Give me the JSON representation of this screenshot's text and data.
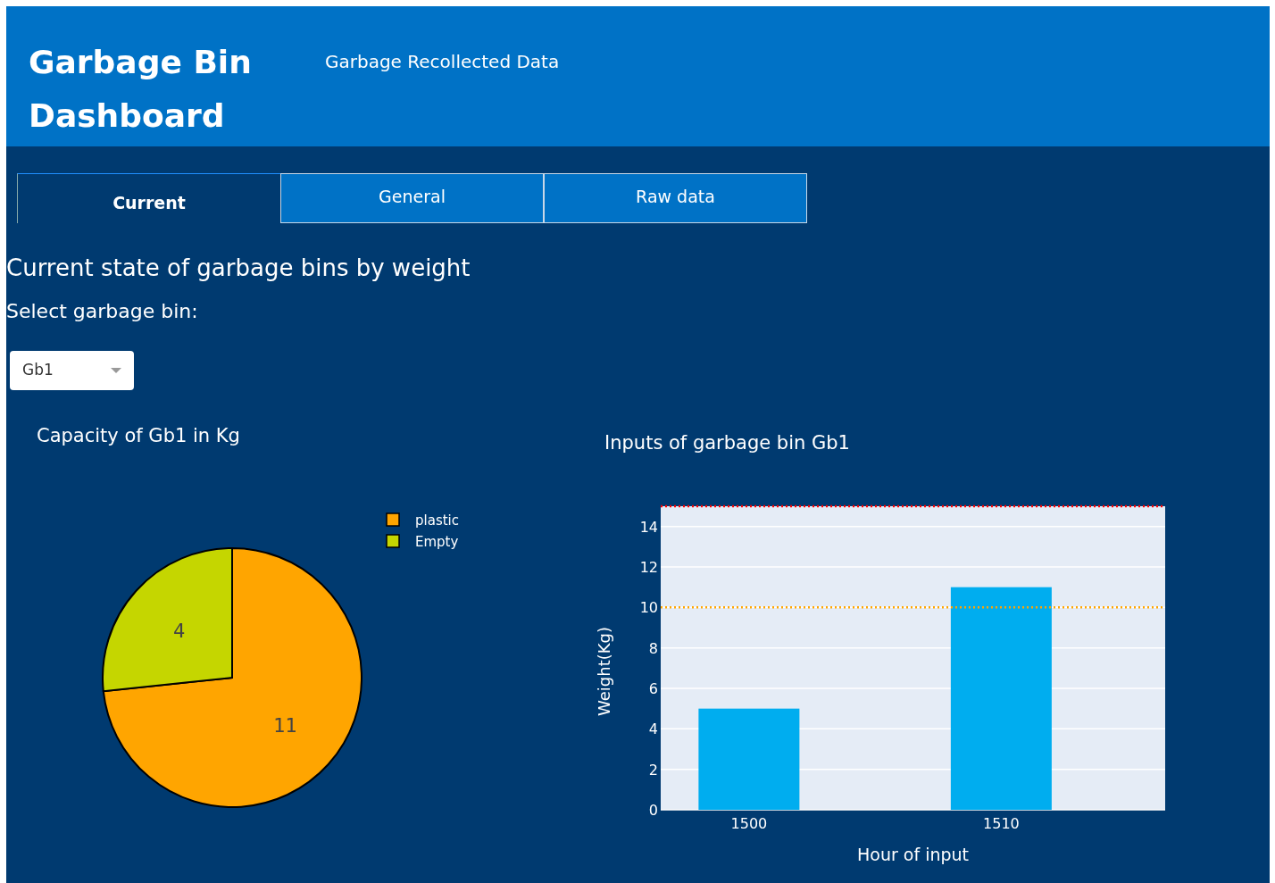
{
  "header": {
    "title": "Garbage Bin Dashboard",
    "subtitle": "Garbage Recollected Data"
  },
  "tabs": [
    {
      "label": "Current",
      "selected": true
    },
    {
      "label": "General",
      "selected": false
    },
    {
      "label": "Raw data",
      "selected": false
    }
  ],
  "heading": "Current state of garbage bins by weight",
  "select_label": "Select garbage bin:",
  "dropdown": {
    "value": "Gb1"
  },
  "pie_chart": {
    "chart_data": {
      "type": "pie",
      "title": "Capacity of Gb1 in Kg",
      "categories": [
        "plastic",
        "Empty"
      ],
      "values": [
        11,
        4
      ],
      "colors": [
        "#ffa500",
        "#c5d600"
      ],
      "data_labels": true,
      "legend": "upper right"
    }
  },
  "bar_chart": {
    "chart_data": {
      "type": "bar",
      "title": "Inputs of garbage bin Gb1",
      "xlabel": "Hour of input",
      "ylabel": "Weight(Kg)",
      "categories": [
        "1500",
        "1510"
      ],
      "series": [
        {
          "color": "#00adef",
          "values": [
            5,
            11
          ]
        }
      ],
      "ylim": [
        0,
        15
      ],
      "yticks": [
        0,
        2,
        4,
        6,
        8,
        10,
        12,
        14
      ],
      "grid": true,
      "ref_lines": [
        {
          "axis": "y",
          "value": 15,
          "color": "#ff0000"
        },
        {
          "axis": "y",
          "value": 10,
          "color": "#ffa500"
        }
      ]
    }
  }
}
